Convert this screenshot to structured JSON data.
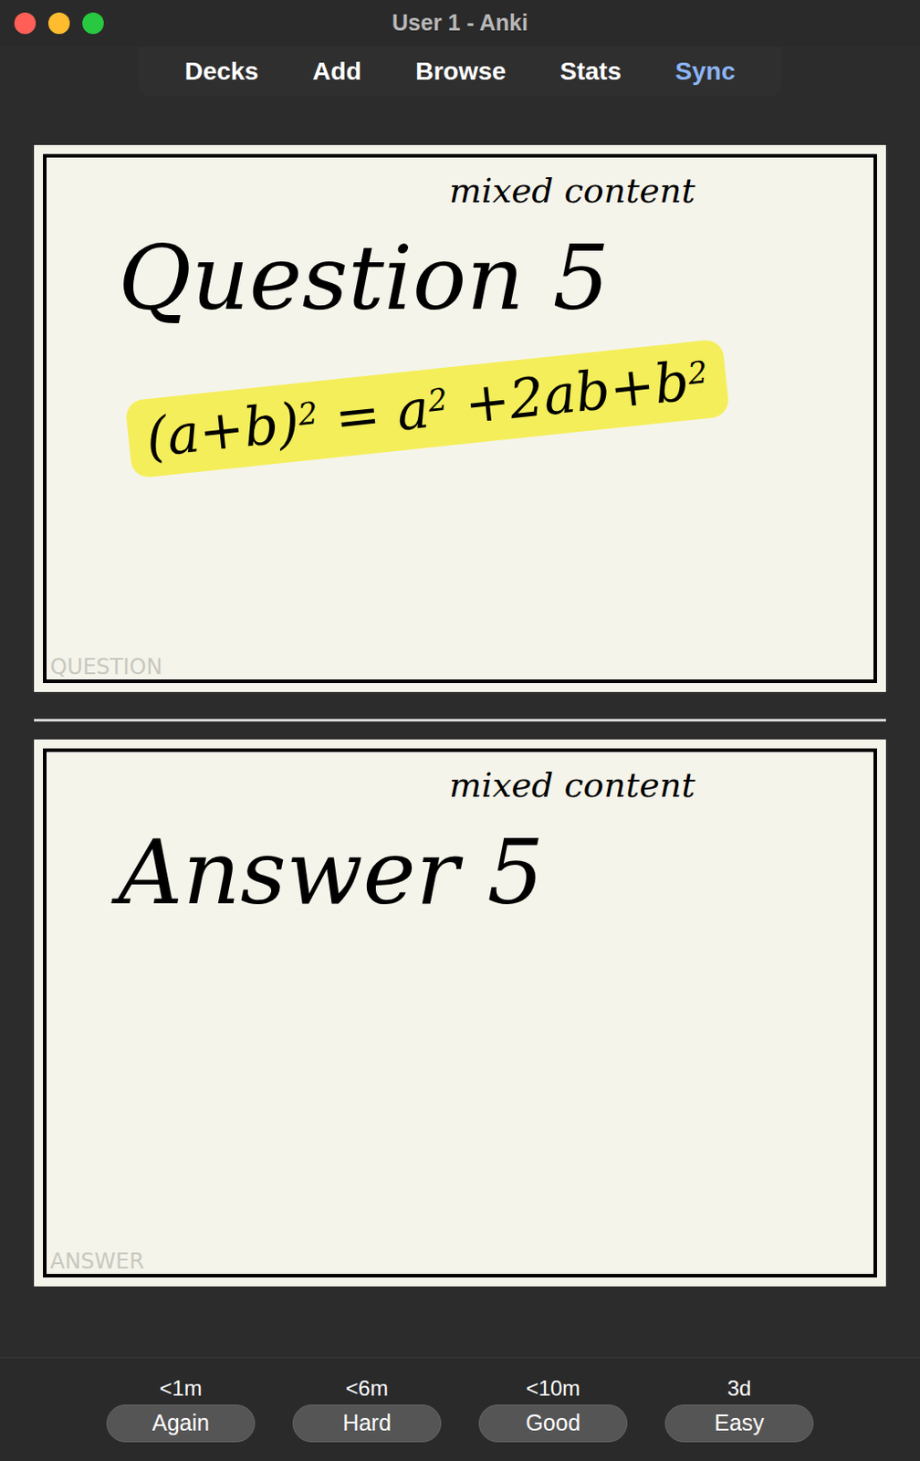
{
  "window": {
    "title": "User 1 - Anki"
  },
  "toolbar": [
    {
      "label": "Decks",
      "highlighted": false
    },
    {
      "label": "Add",
      "highlighted": false
    },
    {
      "label": "Browse",
      "highlighted": false
    },
    {
      "label": "Stats",
      "highlighted": false
    },
    {
      "label": "Sync",
      "highlighted": true
    }
  ],
  "question_card": {
    "note": "mixed content",
    "heading": "Question 5",
    "equation": [
      {
        "text": "(a+b)",
        "kind": "base"
      },
      {
        "text": "2",
        "kind": "sup"
      },
      {
        "text": " = a",
        "kind": "base"
      },
      {
        "text": "2",
        "kind": "sup"
      },
      {
        "text": " +2ab+b",
        "kind": "base"
      },
      {
        "text": "2",
        "kind": "sup"
      }
    ],
    "highlighted": true,
    "watermark": "QUESTION"
  },
  "answer_card": {
    "note": "mixed content",
    "heading": "Answer 5",
    "watermark": "ANSWER"
  },
  "answer_buttons": [
    {
      "label": "Again",
      "interval": "<1m"
    },
    {
      "label": "Hard",
      "interval": "<6m"
    },
    {
      "label": "Good",
      "interval": "<10m"
    },
    {
      "label": "Easy",
      "interval": "3d"
    }
  ]
}
